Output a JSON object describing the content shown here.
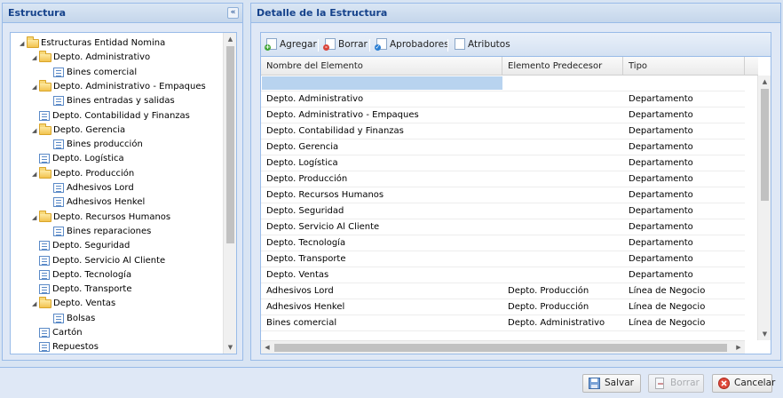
{
  "left_panel": {
    "title": "Estructura",
    "collapse_icon": "double-chevron-left-icon",
    "tree": [
      {
        "label": "Estructuras Entidad Nomina",
        "type": "folder",
        "depth": 0
      },
      {
        "label": "Depto. Administrativo",
        "type": "folder",
        "depth": 1
      },
      {
        "label": "Bines comercial",
        "type": "leaf",
        "depth": 2
      },
      {
        "label": "Depto. Administrativo - Empaques",
        "type": "folder",
        "depth": 1
      },
      {
        "label": "Bines entradas y salidas",
        "type": "leaf",
        "depth": 2
      },
      {
        "label": "Depto. Contabilidad y Finanzas",
        "type": "leaf",
        "depth": 1
      },
      {
        "label": "Depto. Gerencia",
        "type": "folder",
        "depth": 1
      },
      {
        "label": "Bines producción",
        "type": "leaf",
        "depth": 2
      },
      {
        "label": "Depto. Logística",
        "type": "leaf",
        "depth": 1
      },
      {
        "label": "Depto. Producción",
        "type": "folder",
        "depth": 1
      },
      {
        "label": "Adhesivos Lord",
        "type": "leaf",
        "depth": 2
      },
      {
        "label": "Adhesivos Henkel",
        "type": "leaf",
        "depth": 2
      },
      {
        "label": "Depto. Recursos Humanos",
        "type": "folder",
        "depth": 1
      },
      {
        "label": "Bines reparaciones",
        "type": "leaf",
        "depth": 2
      },
      {
        "label": "Depto. Seguridad",
        "type": "leaf",
        "depth": 1
      },
      {
        "label": "Depto. Servicio Al Cliente",
        "type": "leaf",
        "depth": 1
      },
      {
        "label": "Depto. Tecnología",
        "type": "leaf",
        "depth": 1
      },
      {
        "label": "Depto. Transporte",
        "type": "leaf",
        "depth": 1
      },
      {
        "label": "Depto. Ventas",
        "type": "folder",
        "depth": 1
      },
      {
        "label": "Bolsas",
        "type": "leaf",
        "depth": 2
      },
      {
        "label": "Cartón",
        "type": "leaf",
        "depth": 1
      },
      {
        "label": "Repuestos",
        "type": "leaf",
        "depth": 1
      }
    ]
  },
  "right_panel": {
    "title": "Detalle de la Estructura",
    "toolbar": {
      "add_label": "Agregar",
      "delete_label": "Borrar",
      "approvers_label": "Aprobadores",
      "attributes_label": "Atributos"
    },
    "columns": [
      "Nombre del Elemento",
      "Elemento Predecesor",
      "Tipo"
    ],
    "rows": [
      [
        "Depto. Administrativo",
        "",
        "Departamento"
      ],
      [
        "Depto. Administrativo - Empaques",
        "",
        "Departamento"
      ],
      [
        "Depto. Contabilidad y Finanzas",
        "",
        "Departamento"
      ],
      [
        "Depto. Gerencia",
        "",
        "Departamento"
      ],
      [
        "Depto. Logística",
        "",
        "Departamento"
      ],
      [
        "Depto. Producción",
        "",
        "Departamento"
      ],
      [
        "Depto. Recursos Humanos",
        "",
        "Departamento"
      ],
      [
        "Depto. Seguridad",
        "",
        "Departamento"
      ],
      [
        "Depto. Servicio Al Cliente",
        "",
        "Departamento"
      ],
      [
        "Depto. Tecnología",
        "",
        "Departamento"
      ],
      [
        "Depto. Transporte",
        "",
        "Departamento"
      ],
      [
        "Depto. Ventas",
        "",
        "Departamento"
      ],
      [
        "Adhesivos Lord",
        "Depto. Producción",
        "Línea de Negocio"
      ],
      [
        "Adhesivos Henkel",
        "Depto. Producción",
        "Línea de Negocio"
      ],
      [
        "Bines comercial",
        "Depto. Administrativo",
        "Línea de Negocio"
      ]
    ]
  },
  "footer": {
    "save_label": "Salvar",
    "delete_label": "Borrar",
    "cancel_label": "Cancelar"
  },
  "colors": {
    "panel_title": "#15428b",
    "panel_border": "#99bbe8",
    "editor_cell": "#b8d3ef"
  }
}
